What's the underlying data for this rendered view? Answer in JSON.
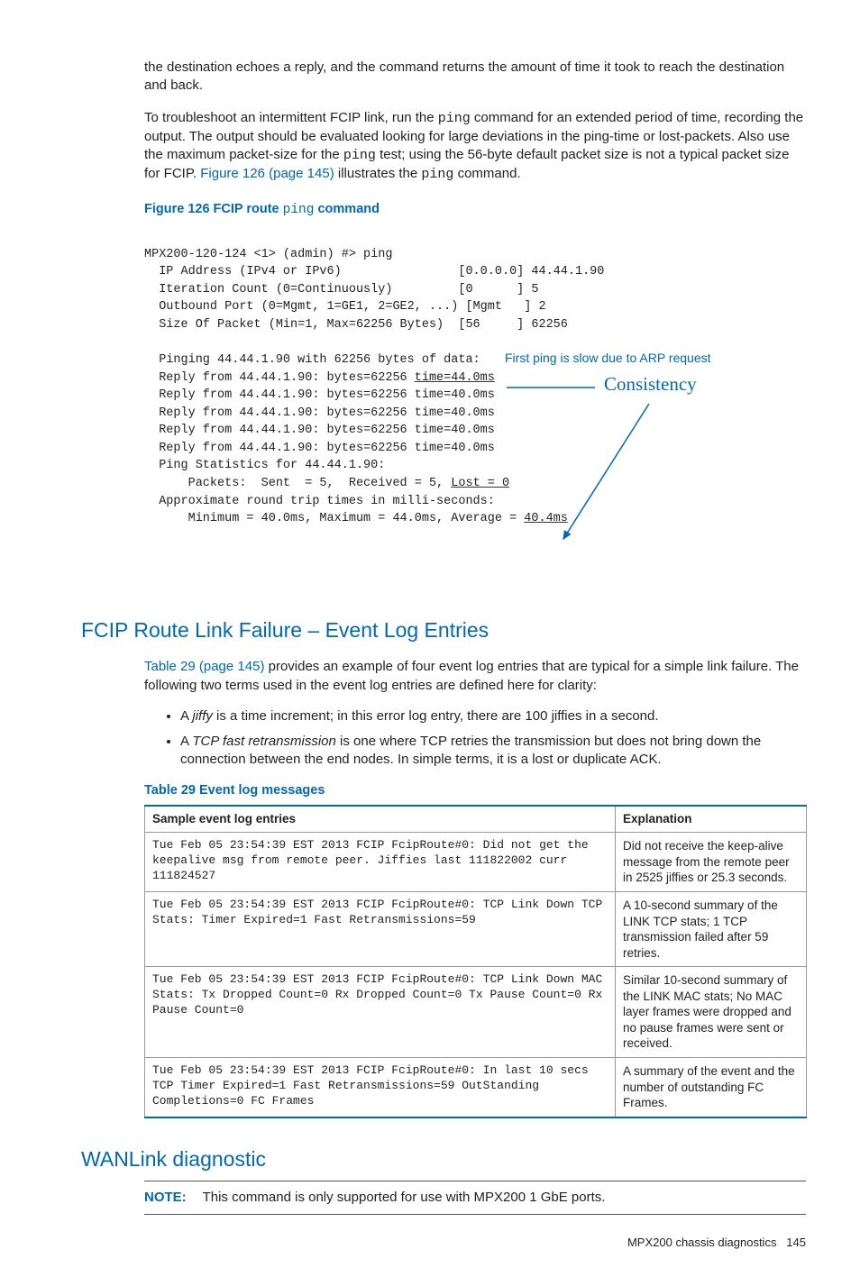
{
  "para1": "the destination echoes a reply, and the command returns the amount of time it took to reach the destination and back.",
  "para2_a": "To troubleshoot an intermittent FCIP link, run the ",
  "para2_b": " command for an extended period of time, recording the output. The output should be evaluated looking for large deviations in the ping-time or lost-packets. Also use the maximum packet-size for the ",
  "para2_c": " test; using the 56-byte default packet size is not a typical packet size for FCIP. ",
  "para2_d": " illustrates the ",
  "para2_e": " command.",
  "ping_code": "ping",
  "fig126_link": "Figure 126 (page 145)",
  "fig126_caption_a": "Figure 126 FCIP route ",
  "fig126_caption_b": " command",
  "fig_lines": {
    "l0": "MPX200-120-124 <1> (admin) #> ping",
    "l1": "  IP Address (IPv4 or IPv6)                [0.0.0.0] 44.44.1.90",
    "l2": "  Iteration Count (0=Continuously)         [0      ] 5",
    "l3": "  Outbound Port (0=Mgmt, 1=GE1, 2=GE2, ...) [Mgmt   ] 2",
    "l4": "  Size Of Packet (Min=1, Max=62256 Bytes)  [56     ] 62256",
    "l5": "",
    "l6": "  Pinging 44.44.1.90 with 62256 bytes of data:",
    "l7a": "  Reply from 44.44.1.90: bytes=62256 ",
    "l7b": "time=44.0ms",
    "l8": "  Reply from 44.44.1.90: bytes=62256 time=40.0ms",
    "l9": "  Reply from 44.44.1.90: bytes=62256 time=40.0ms",
    "l10": "  Reply from 44.44.1.90: bytes=62256 time=40.0ms",
    "l11": "  Reply from 44.44.1.90: bytes=62256 time=40.0ms",
    "l12": "  Ping Statistics for 44.44.1.90:",
    "l13a": "      Packets:  Sent  = 5,  Received = 5, ",
    "l13b": "Lost = 0",
    "l14": "  Approximate round trip times in milli-seconds:",
    "l15a": "      Minimum = 40.0ms, Maximum = 44.0ms, Average = ",
    "l15b": "40.4ms"
  },
  "annot_first_ping": "First ping is slow due to ARP request",
  "annot_consistency": "Consistency",
  "h2_fcip": "FCIP Route Link Failure – Event Log Entries",
  "fcip_para_a": " provides an example of four event log entries that are typical for a simple link failure. The following two terms used in the event log entries are defined here for clarity:",
  "table29_link": "Table 29 (page 145)",
  "bullet1_a": "A ",
  "bullet1_term": "jiffy",
  "bullet1_b": " is a time increment; in this error log entry, there are 100 jiffies in a second.",
  "bullet2_a": "A ",
  "bullet2_term": "TCP fast retransmission",
  "bullet2_b": " is one where TCP retries the transmission but does not bring down the connection between the end nodes. In simple terms, it is a lost or duplicate ACK.",
  "table29_caption": "Table 29 Event log messages",
  "table": {
    "hdr_sample": "Sample event log entries",
    "hdr_expl": "Explanation",
    "rows": [
      {
        "sample": "Tue Feb 05 23:54:39 EST 2013 FCIP FcipRoute#0: Did not get the keepalive msg from remote peer. Jiffies last 111822002 curr 111824527",
        "expl": "Did not receive the keep-alive message from the remote peer in 2525 jiffies or 25.3 seconds."
      },
      {
        "sample": "Tue Feb 05 23:54:39 EST 2013 FCIP FcipRoute#0: TCP Link Down TCP Stats: Timer Expired=1 Fast Retransmissions=59",
        "expl": "A 10-second summary of the LINK TCP stats; 1 TCP transmission failed after 59 retries."
      },
      {
        "sample": "Tue Feb 05 23:54:39 EST 2013 FCIP FcipRoute#0: TCP Link Down MAC Stats: Tx Dropped Count=0 Rx Dropped Count=0 Tx Pause Count=0 Rx Pause Count=0",
        "expl": "Similar 10-second summary of the LINK MAC stats; No MAC layer frames were dropped and no pause frames were sent or received."
      },
      {
        "sample": "Tue Feb 05 23:54:39 EST 2013 FCIP FcipRoute#0: In last 10 secs TCP Timer Expired=1 Fast Retransmissions=59 OutStanding Completions=0 FC Frames",
        "expl": "A summary of the event and the number of outstanding FC Frames."
      }
    ]
  },
  "h2_wanlink": "WANLink diagnostic",
  "note_label": "NOTE:",
  "note_text": "This command is only supported for use with MPX200 1 GbE ports.",
  "footer_text": "MPX200 chassis diagnostics",
  "footer_page": "145"
}
